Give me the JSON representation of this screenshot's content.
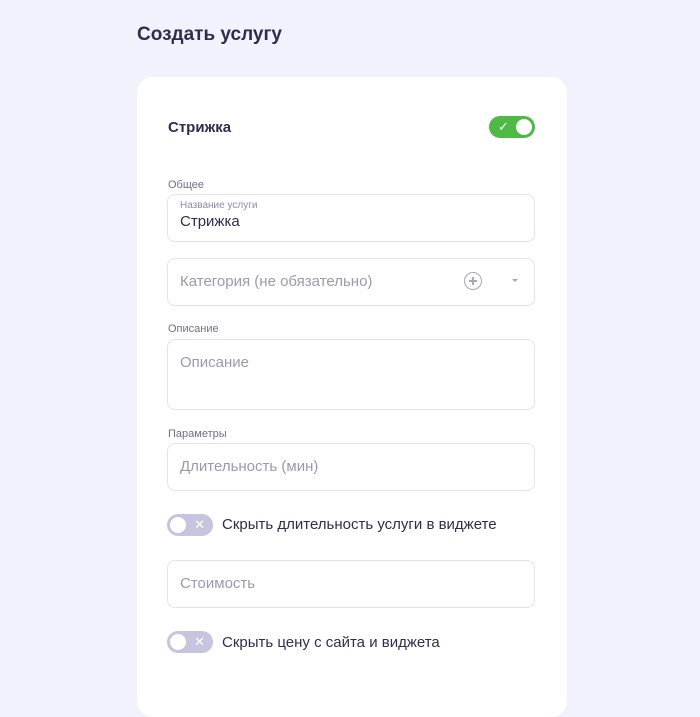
{
  "page": {
    "title": "Создать услугу"
  },
  "service": {
    "name": "Стрижка",
    "active_toggle_on": true,
    "check_glyph": "✓"
  },
  "general": {
    "section_label": "Общее",
    "name_field": {
      "label": "Название услуги",
      "value": "Стрижка"
    },
    "category_field": {
      "placeholder": "Категория (не обязательно)"
    }
  },
  "description": {
    "section_label": "Описание",
    "field": {
      "placeholder": "Описание"
    }
  },
  "parameters": {
    "section_label": "Параметры",
    "duration_field": {
      "placeholder": "Длительность (мин)"
    },
    "hide_duration": {
      "label": "Скрыть длительность услуги в виджете",
      "on": false,
      "glyph": "✕"
    },
    "price_field": {
      "placeholder": "Стоимость"
    },
    "hide_price": {
      "label": "Скрыть цену с сайта и виджета",
      "on": false,
      "glyph": "✕"
    }
  },
  "colors": {
    "background": "#f1f2fc",
    "toggle_on": "#4eba45",
    "toggle_off": "#c6c4de"
  },
  "icons": {
    "add_category": "plus-circle-icon",
    "category_dropdown": "chevron-down-icon",
    "check": "check-icon",
    "cross": "close-icon"
  }
}
